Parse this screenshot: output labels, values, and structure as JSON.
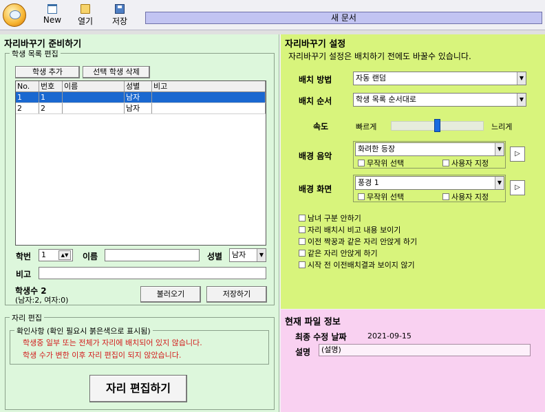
{
  "toolbar": {
    "new_label": "New",
    "open_label": "열기",
    "save_label": "저장",
    "document_title": "새 문서"
  },
  "left": {
    "title": "자리바꾸기 준비하기",
    "student_group_label": "학생 목록 편집",
    "add_student_label": "학생 추가",
    "delete_selected_label": "선택 학생 삭제",
    "columns": [
      "No.",
      "번호",
      "이름",
      "성별",
      "비고"
    ],
    "rows": [
      {
        "no": "1",
        "num": "1",
        "name": "",
        "gender": "남자",
        "note": ""
      },
      {
        "no": "2",
        "num": "2",
        "name": "",
        "gender": "남자",
        "note": ""
      }
    ],
    "student_number_label": "학번",
    "student_number_value": "1",
    "name_label": "이름",
    "name_value": "",
    "gender_label": "성별",
    "gender_value": "남자",
    "note_label": "비고",
    "note_value": "",
    "count_label": "학생수 2",
    "count_detail": "(남자:2, 여자:0)",
    "load_label": "불러오기",
    "save_label": "저장하기",
    "seat_group_label": "자리 편집",
    "check_group_label": "확인사항 (확인 필요시 붉은색으로 표시됨)",
    "warning_1": "학생중 일부 또는 전체가 자리에 배치되어 있지 않습니다.",
    "warning_2": "학생 수가 변한 이후 자리 편집이 되지 않았습니다.",
    "edit_seats_label": "자리 편집하기"
  },
  "settings": {
    "title": "자리바꾸기 설정",
    "subtitle": "자리바꾸기 설정은 배치하기 전에도 바꿀수 있습니다.",
    "method_label": "배치 방법",
    "method_value": "자동 랜덤",
    "order_label": "배치 순서",
    "order_value": "학생 목록 순서대로",
    "speed_label": "속도",
    "speed_fast": "빠르게",
    "speed_slow": "느리게",
    "speed_level": 0.5,
    "music_label": "배경 음악",
    "music_value": "화려한 등장",
    "music_random": "무작위 선택",
    "music_user": "사용자 지정",
    "screen_label": "배경 화면",
    "screen_value": "풍경 1",
    "screen_random": "무작위 선택",
    "screen_user": "사용자 지정",
    "options": [
      "남녀 구분 안하기",
      "자리 배치시 비고 내용 보이기",
      "이전 짝꿍과 같은 자리 안앉게 하기",
      "같은 자리 안앉게 하기",
      "시작 전 이전배치결과 보이지 않기"
    ]
  },
  "file_info": {
    "title": "현재 파일 정보",
    "modified_label": "최종 수정 날짜",
    "modified_value": "2021-09-15",
    "desc_label": "설명",
    "desc_value": "(설명)"
  }
}
